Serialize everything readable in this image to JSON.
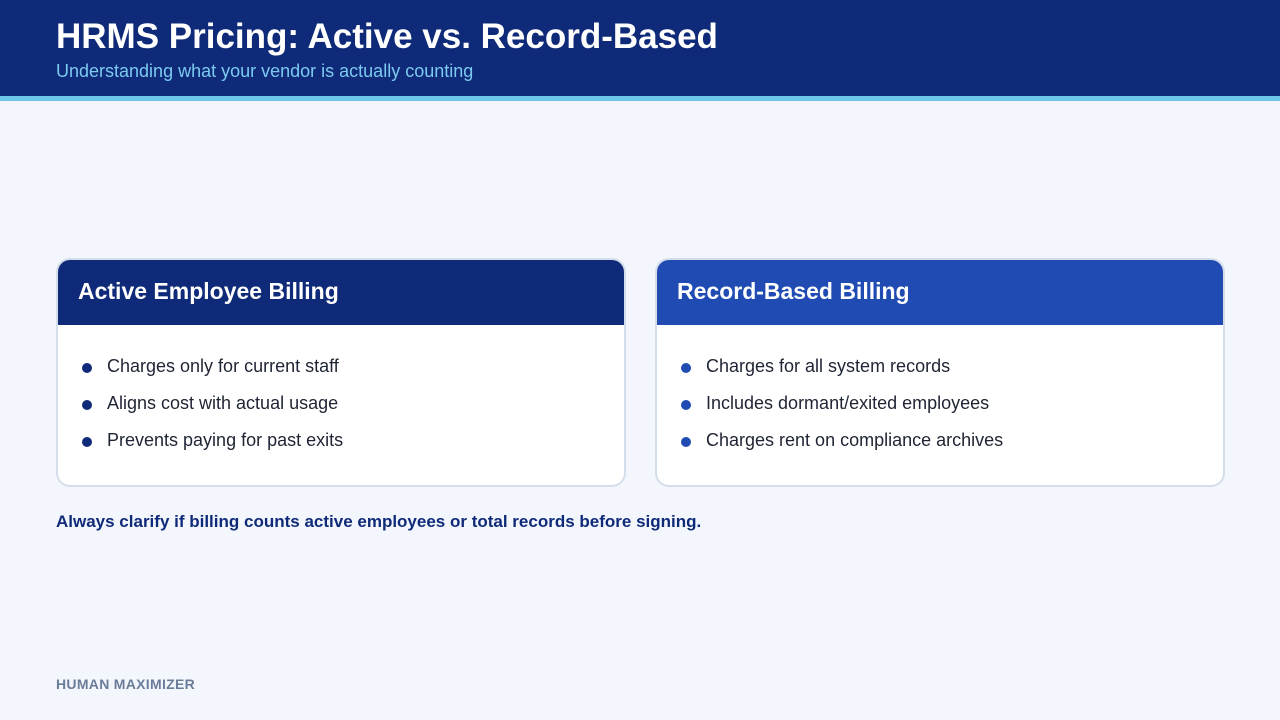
{
  "header": {
    "title": "HRMS Pricing: Active vs. Record-Based",
    "subtitle": "Understanding what your vendor is actually counting"
  },
  "cards": [
    {
      "title": "Active Employee Billing",
      "items": [
        "Charges only for current staff",
        "Aligns cost with actual usage",
        "Prevents paying for past exits"
      ]
    },
    {
      "title": "Record-Based Billing",
      "items": [
        "Charges for all system records",
        "Includes dormant/exited employees",
        "Charges rent on compliance archives"
      ]
    }
  ],
  "callout": "Always clarify if billing counts active employees or total records before signing.",
  "footer": "HUMAN MAXIMIZER",
  "colors": {
    "header_bg": "#0f2a78",
    "accent_rule": "#6ec6ea",
    "card_left_head": "#0f2a78",
    "card_right_head": "#1f4bb3",
    "page_bg": "#f3f7fd"
  }
}
